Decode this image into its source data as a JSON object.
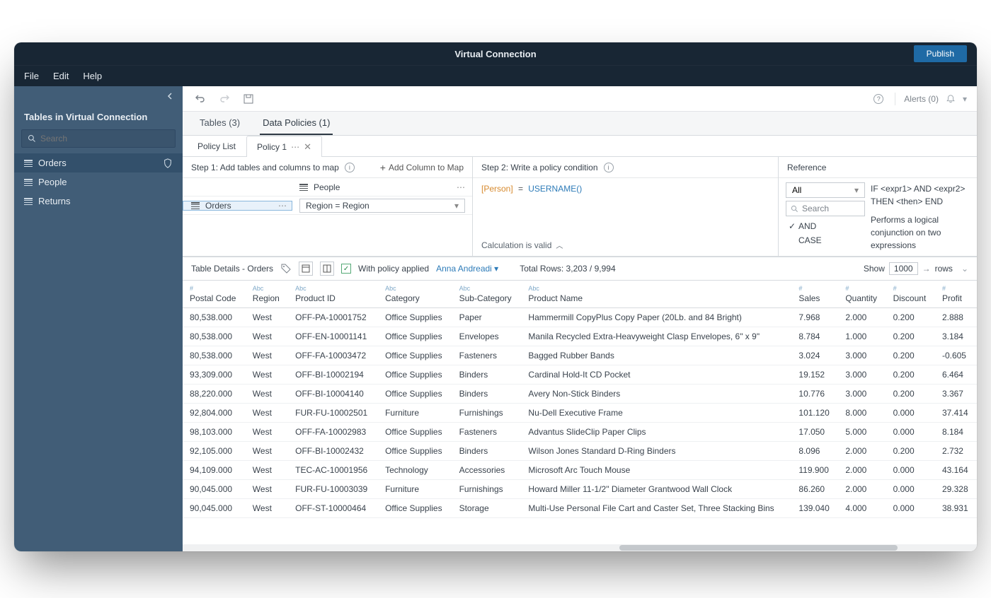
{
  "window_title": "Virtual Connection",
  "publish_label": "Publish",
  "menu": [
    "File",
    "Edit",
    "Help"
  ],
  "sidebar": {
    "title": "Tables in Virtual Connection",
    "search_placeholder": "Search",
    "tables": [
      {
        "name": "Orders",
        "active": true,
        "shield": true
      },
      {
        "name": "People",
        "active": false,
        "shield": false
      },
      {
        "name": "Returns",
        "active": false,
        "shield": false
      }
    ]
  },
  "toolbar": {
    "alerts_label": "Alerts (0)"
  },
  "main_tabs": [
    {
      "label": "Tables (3)",
      "active": false
    },
    {
      "label": "Data Policies (1)",
      "active": true
    }
  ],
  "policy_tabs": [
    {
      "label": "Policy List",
      "active": false,
      "closable": false
    },
    {
      "label": "Policy 1",
      "active": true,
      "closable": true
    }
  ],
  "step1": {
    "title": "Step 1: Add tables and columns to map",
    "add_col_label": "Add Column to Map",
    "rows": [
      {
        "left": "",
        "right_table": "People",
        "right_more": true
      },
      {
        "left": "Orders",
        "selected": true,
        "region_select": "Region = Region"
      }
    ]
  },
  "step2": {
    "title": "Step 2: Write a policy condition",
    "expr_field": "[Person]",
    "expr_eq": "=",
    "expr_fn": "USERNAME()",
    "valid_label": "Calculation is valid"
  },
  "reference": {
    "title": "Reference",
    "filter_all": "All",
    "search_placeholder": "Search",
    "items": [
      "AND",
      "CASE"
    ],
    "checked_index": 0,
    "template": "IF <expr1> AND <expr2> THEN <then> END",
    "desc": "Performs a logical conjunction on two expressions"
  },
  "details": {
    "title": "Table Details - Orders",
    "policy_applied_label": "With policy applied",
    "user": "Anna Andreadi",
    "total_rows_label": "Total Rows: 3,203 / 9,994",
    "show_label": "Show",
    "show_value": "1000",
    "rows_label": "rows"
  },
  "columns": [
    {
      "type": "#",
      "name": "Postal Code"
    },
    {
      "type": "Abc",
      "name": "Region"
    },
    {
      "type": "Abc",
      "name": "Product ID"
    },
    {
      "type": "Abc",
      "name": "Category"
    },
    {
      "type": "Abc",
      "name": "Sub-Category"
    },
    {
      "type": "Abc",
      "name": "Product Name"
    },
    {
      "type": "#",
      "name": "Sales"
    },
    {
      "type": "#",
      "name": "Quantity"
    },
    {
      "type": "#",
      "name": "Discount"
    },
    {
      "type": "#",
      "name": "Profit"
    }
  ],
  "rows": [
    [
      "80,538.000",
      "West",
      "OFF-PA-10001752",
      "Office Supplies",
      "Paper",
      "Hammermill CopyPlus Copy Paper (20Lb. and 84 Bright)",
      "7.968",
      "2.000",
      "0.200",
      "2.888"
    ],
    [
      "80,538.000",
      "West",
      "OFF-EN-10001141",
      "Office Supplies",
      "Envelopes",
      "Manila Recycled Extra-Heavyweight Clasp Envelopes, 6\" x 9\"",
      "8.784",
      "1.000",
      "0.200",
      "3.184"
    ],
    [
      "80,538.000",
      "West",
      "OFF-FA-10003472",
      "Office Supplies",
      "Fasteners",
      "Bagged Rubber Bands",
      "3.024",
      "3.000",
      "0.200",
      "-0.605"
    ],
    [
      "93,309.000",
      "West",
      "OFF-BI-10002194",
      "Office Supplies",
      "Binders",
      "Cardinal Hold-It CD Pocket",
      "19.152",
      "3.000",
      "0.200",
      "6.464"
    ],
    [
      "88,220.000",
      "West",
      "OFF-BI-10004140",
      "Office Supplies",
      "Binders",
      "Avery Non-Stick Binders",
      "10.776",
      "3.000",
      "0.200",
      "3.367"
    ],
    [
      "92,804.000",
      "West",
      "FUR-FU-10002501",
      "Furniture",
      "Furnishings",
      "Nu-Dell Executive Frame",
      "101.120",
      "8.000",
      "0.000",
      "37.414"
    ],
    [
      "98,103.000",
      "West",
      "OFF-FA-10002983",
      "Office Supplies",
      "Fasteners",
      "Advantus SlideClip Paper Clips",
      "17.050",
      "5.000",
      "0.000",
      "8.184"
    ],
    [
      "92,105.000",
      "West",
      "OFF-BI-10002432",
      "Office Supplies",
      "Binders",
      "Wilson Jones Standard D-Ring Binders",
      "8.096",
      "2.000",
      "0.200",
      "2.732"
    ],
    [
      "94,109.000",
      "West",
      "TEC-AC-10001956",
      "Technology",
      "Accessories",
      "Microsoft Arc Touch Mouse",
      "119.900",
      "2.000",
      "0.000",
      "43.164"
    ],
    [
      "90,045.000",
      "West",
      "FUR-FU-10003039",
      "Furniture",
      "Furnishings",
      "Howard Miller 11-1/2\" Diameter Grantwood Wall Clock",
      "86.260",
      "2.000",
      "0.000",
      "29.328"
    ],
    [
      "90,045.000",
      "West",
      "OFF-ST-10000464",
      "Office Supplies",
      "Storage",
      "Multi-Use Personal File Cart and Caster Set, Three Stacking Bins",
      "139.040",
      "4.000",
      "0.000",
      "38.931"
    ]
  ]
}
